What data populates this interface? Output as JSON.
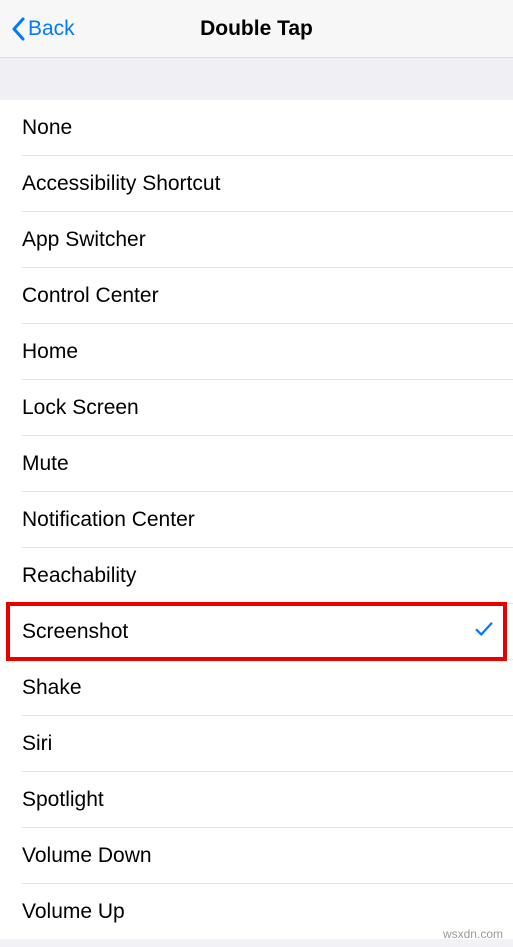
{
  "nav": {
    "back": "Back",
    "title": "Double Tap"
  },
  "options": [
    {
      "label": "None",
      "selected": false,
      "highlight": false
    },
    {
      "label": "Accessibility Shortcut",
      "selected": false,
      "highlight": false
    },
    {
      "label": "App Switcher",
      "selected": false,
      "highlight": false
    },
    {
      "label": "Control Center",
      "selected": false,
      "highlight": false
    },
    {
      "label": "Home",
      "selected": false,
      "highlight": false
    },
    {
      "label": "Lock Screen",
      "selected": false,
      "highlight": false
    },
    {
      "label": "Mute",
      "selected": false,
      "highlight": false
    },
    {
      "label": "Notification Center",
      "selected": false,
      "highlight": false
    },
    {
      "label": "Reachability",
      "selected": false,
      "highlight": false
    },
    {
      "label": "Screenshot",
      "selected": true,
      "highlight": true
    },
    {
      "label": "Shake",
      "selected": false,
      "highlight": false
    },
    {
      "label": "Siri",
      "selected": false,
      "highlight": false
    },
    {
      "label": "Spotlight",
      "selected": false,
      "highlight": false
    },
    {
      "label": "Volume Down",
      "selected": false,
      "highlight": false
    },
    {
      "label": "Volume Up",
      "selected": false,
      "highlight": false
    }
  ],
  "watermark": "wsxdn.com"
}
